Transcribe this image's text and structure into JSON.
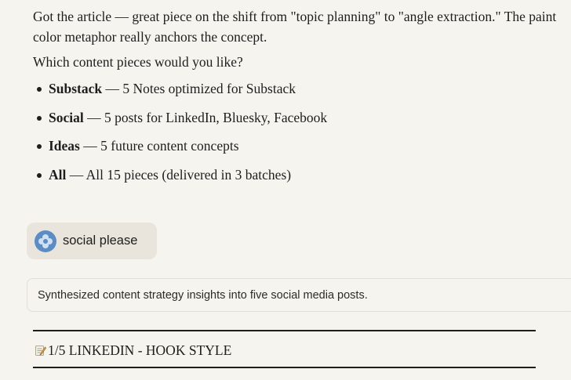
{
  "assistant_message": {
    "intro": "Got the article — great piece on the shift from \"topic planning\" to \"angle extraction.\" The paint color metaphor really anchors the concept.",
    "question": "Which content pieces would you like?",
    "options": [
      {
        "name": "Substack",
        "description": "— 5 Notes optimized for Substack"
      },
      {
        "name": "Social",
        "description": "— 5 posts for LinkedIn, Bluesky, Facebook"
      },
      {
        "name": "Ideas",
        "description": "— 5 future content concepts"
      },
      {
        "name": "All",
        "description": "— All 15 pieces (delivered in 3 batches)"
      }
    ]
  },
  "user_message": {
    "text": "social please",
    "avatar_icon": "flower-avatar-icon",
    "avatar_color": "#5b8cc4"
  },
  "thinking_summary": {
    "text": "Synthesized content strategy insights into five social media posts."
  },
  "section": {
    "icon": "memo-icon",
    "heading": "1/5 LINKEDIN - HOOK STYLE"
  }
}
